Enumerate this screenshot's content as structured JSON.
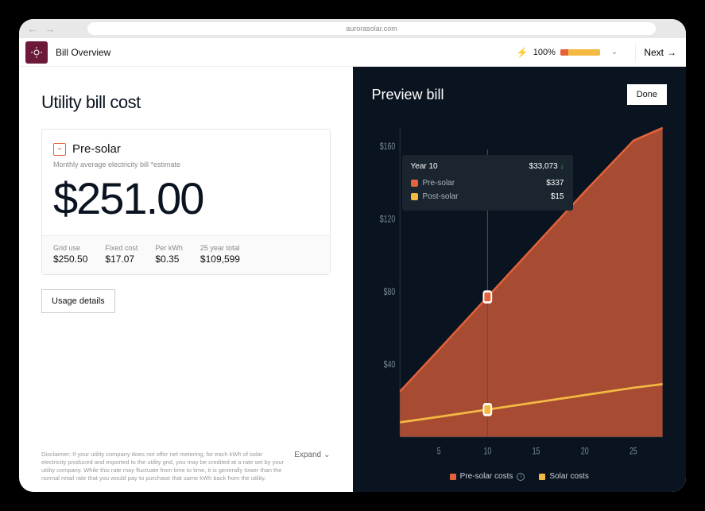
{
  "browser": {
    "url": "aurorasolar.com"
  },
  "header": {
    "title": "Bill Overview",
    "progress_pct": "100%",
    "next_label": "Next"
  },
  "left": {
    "section_title": "Utility bill cost",
    "card_title": "Pre-solar",
    "card_sub": "Monthly average electricity bill *estimate",
    "amount": "$251.00",
    "stats": [
      {
        "label": "Grid use",
        "value": "$250.50"
      },
      {
        "label": "Fixed cost",
        "value": "$17.07"
      },
      {
        "label": "Per kWh",
        "value": "$0.35"
      },
      {
        "label": "25 year total",
        "value": "$109,599"
      }
    ],
    "usage_btn": "Usage details",
    "disclaimer": "Disclaimer: If your utility company does not offer net metering, for each kWh of solar electricity produced and exported to the utility grid, you may be credited at a rate set by your utility company. While this rate may fluctuate from time to time, it is generally lower than the normal retail rate that you would pay to purchase that same kWh back from the utility.",
    "expand_label": "Expand"
  },
  "right": {
    "title": "Preview bill",
    "done_label": "Done",
    "tooltip": {
      "title": "Year 10",
      "total": "$33,073",
      "rows": [
        {
          "label": "Pre-solar",
          "value": "$337"
        },
        {
          "label": "Post-solar",
          "value": "$15"
        }
      ]
    },
    "legend": {
      "pre": "Pre-solar costs",
      "solar": "Solar costs"
    }
  },
  "chart_data": {
    "type": "area",
    "xlabel": "",
    "ylabel": "",
    "x_ticks": [
      5,
      10,
      15,
      20,
      25
    ],
    "y_ticks": [
      40,
      80,
      120,
      160
    ],
    "ylim": [
      0,
      170
    ],
    "xlim": [
      1,
      28
    ],
    "series": [
      {
        "name": "Pre-solar costs",
        "color": "#e5633a",
        "x": [
          1,
          5,
          10,
          15,
          20,
          25,
          28
        ],
        "y": [
          25,
          48,
          77,
          106,
          135,
          163,
          170
        ]
      },
      {
        "name": "Solar costs",
        "color": "#f4b942",
        "x": [
          1,
          5,
          10,
          15,
          20,
          25,
          28
        ],
        "y": [
          8,
          11,
          15,
          19,
          23,
          27,
          29
        ]
      }
    ],
    "marker_x": 10
  }
}
